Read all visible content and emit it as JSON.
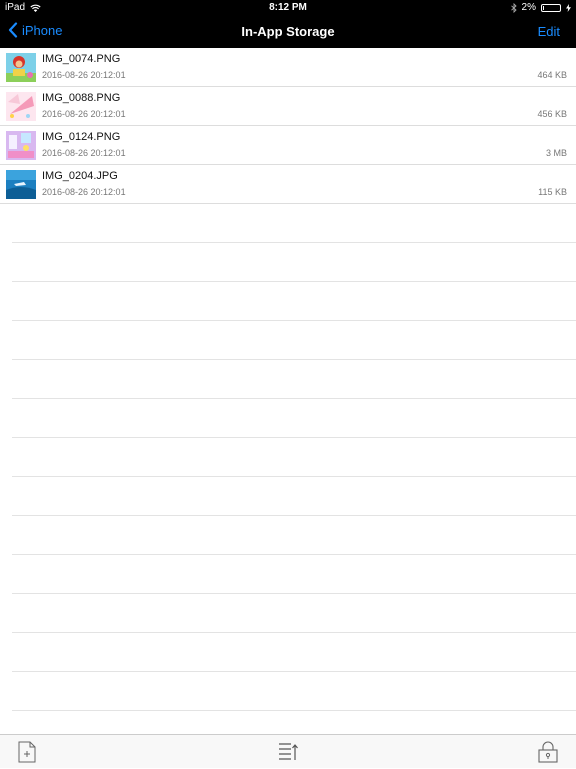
{
  "status": {
    "device": "iPad",
    "time": "8:12 PM",
    "battery": "2%",
    "battery_level": 0.02
  },
  "nav": {
    "back_label": "iPhone",
    "title": "In-App Storage",
    "edit_label": "Edit"
  },
  "files": [
    {
      "name": "IMG_0074.PNG",
      "date": "2016-08-26 20:12:01",
      "size": "464 KB"
    },
    {
      "name": "IMG_0088.PNG",
      "date": "2016-08-26 20:12:01",
      "size": "456 KB"
    },
    {
      "name": "IMG_0124.PNG",
      "date": "2016-08-26 20:12:01",
      "size": "3 MB"
    },
    {
      "name": "IMG_0204.JPG",
      "date": "2016-08-26 20:12:01",
      "size": "115 KB"
    }
  ],
  "toolbar": {
    "icons": [
      "new-document-icon",
      "sort-list-icon",
      "lock-icon"
    ]
  },
  "colors": {
    "accent": "#1a8cff",
    "bar": "#000000"
  }
}
